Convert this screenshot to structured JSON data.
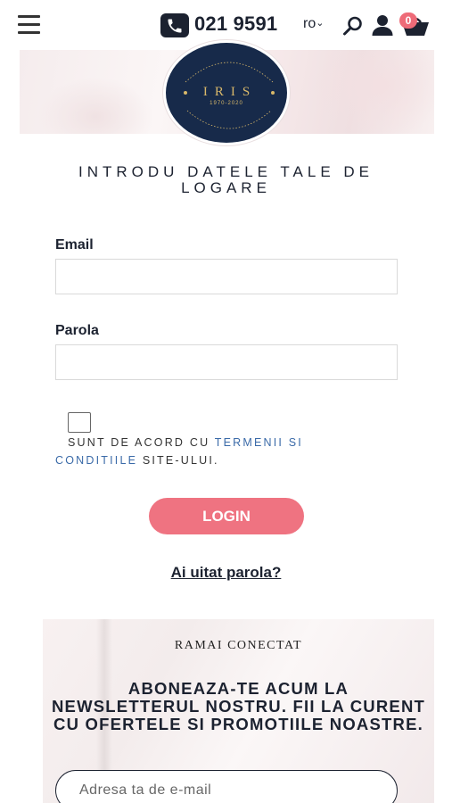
{
  "header": {
    "phone": "021 9591",
    "language": "ro",
    "cart_count": "0"
  },
  "logo": {
    "name": "IRIS",
    "years": "1970-2020"
  },
  "login": {
    "title": "INTRODU DATELE TALE DE LOGARE",
    "email_label": "Email",
    "password_label": "Parola",
    "terms_prefix": "SUNT DE ACORD CU ",
    "terms_link": "TERMENII SI CONDITIILE",
    "terms_suffix": " SITE-ULUI.",
    "button": "LOGIN",
    "forgot": "Ai uitat parola?"
  },
  "newsletter": {
    "kicker": "RAMAI CONECTAT",
    "headline": "ABONEAZA-TE ACUM LA NEWSLETTERUL NOSTRU. FII LA CURENT CU OFERTELE SI PROMOTIILE NOASTRE.",
    "email_placeholder": "Adresa ta de e-mail"
  },
  "colors": {
    "navy": "#1c2230",
    "login_button": "#ef7381",
    "link": "#3a6aa8",
    "badge": "#ee6b78"
  }
}
